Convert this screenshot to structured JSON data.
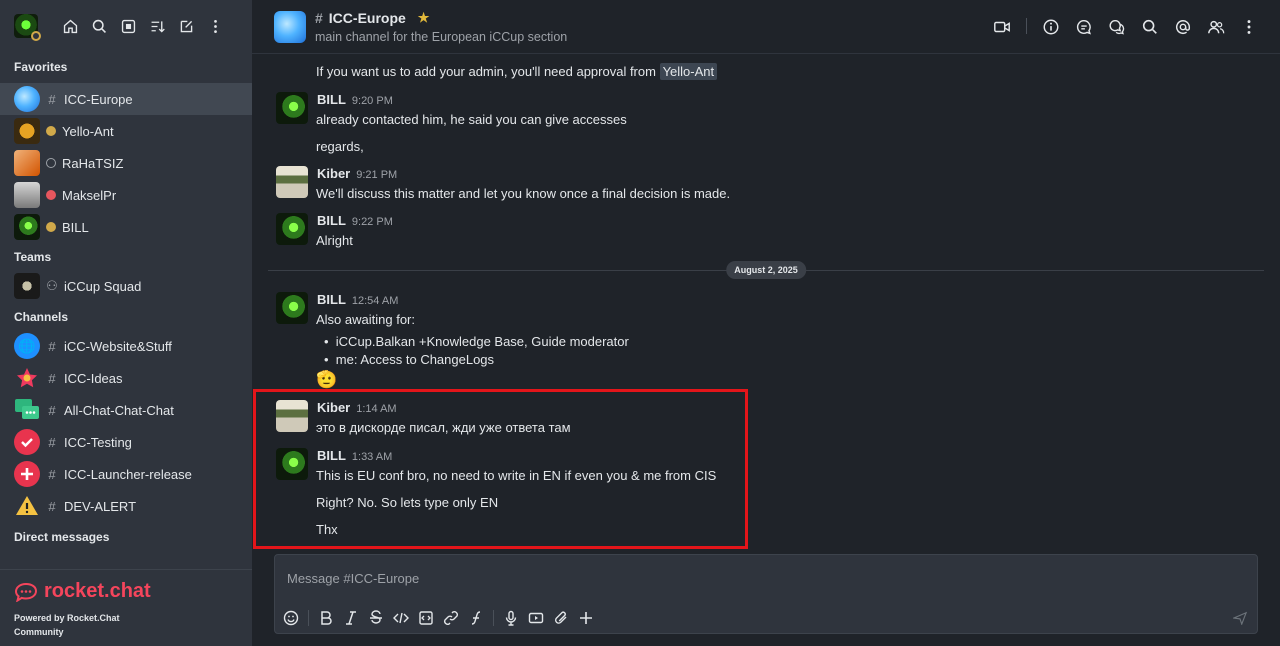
{
  "sidebar": {
    "favorites_title": "Favorites",
    "favorites": [
      {
        "label": "ICC-Europe",
        "symbol": "#",
        "active": true
      },
      {
        "label": "Yello-Ant",
        "status": "away"
      },
      {
        "label": "RaHaTSIZ",
        "status": "offline"
      },
      {
        "label": "MakselPr",
        "status": "busy"
      },
      {
        "label": "BILL",
        "status": "away"
      }
    ],
    "teams_title": "Teams",
    "teams": [
      {
        "label": "iCCup Squad"
      }
    ],
    "channels_title": "Channels",
    "channels": [
      {
        "label": "iCC-Website&Stuff",
        "symbol": "#"
      },
      {
        "label": "ICC-Ideas",
        "symbol": "#"
      },
      {
        "label": "All-Chat-Chat-Chat",
        "symbol": "#"
      },
      {
        "label": "ICC-Testing",
        "symbol": "#"
      },
      {
        "label": "ICC-Launcher-release",
        "symbol": "#"
      },
      {
        "label": "DEV-ALERT",
        "symbol": "#"
      }
    ],
    "dm_title": "Direct messages",
    "footer": {
      "logo": "rocket.chat",
      "powered": "Powered by Rocket.Chat",
      "edition": "Community"
    }
  },
  "header": {
    "title": "ICC-Europe",
    "topic": "main channel for the European iCCup section",
    "symbol": "#"
  },
  "messages": [
    {
      "text_pre": "If you want us to add your admin, you'll need approval from ",
      "mention": "Yello-Ant"
    },
    {
      "author": "BILL",
      "time": "9:20 PM",
      "lines": [
        "already contacted him, he said you can give accesses",
        "regards,"
      ]
    },
    {
      "author": "Kiber",
      "time": "9:21 PM",
      "lines": [
        "We'll discuss this matter and let you know once a final decision is made."
      ]
    },
    {
      "author": "BILL",
      "time": "9:22 PM",
      "lines": [
        "Alright"
      ]
    },
    {
      "author": "BILL",
      "time": "12:54 AM",
      "lines": [
        "Also awaiting for:"
      ],
      "bullets": [
        "iCCup.Balkan +Knowledge Base, Guide moderator",
        "me: Access to ChangeLogs"
      ],
      "emoji": "🫡"
    },
    {
      "author": "Kiber",
      "time": "1:14 AM",
      "lines": [
        "это в дискорде писал, жди уже ответа там"
      ]
    },
    {
      "author": "BILL",
      "time": "1:33 AM",
      "lines": [
        "This is EU conf bro, no need to write in EN if even you & me from CIS",
        "Right? No. So lets type only EN",
        "Thx"
      ]
    }
  ],
  "date_divider": "August 2, 2025",
  "composer": {
    "placeholder": "Message #ICC-Europe"
  },
  "colors": {
    "sidebar": "#2f343d",
    "main": "#1f2329",
    "accent_red": "#f5455c",
    "highlight": "#e3151a",
    "away": "#d1a94a",
    "busy": "#e7565e"
  }
}
